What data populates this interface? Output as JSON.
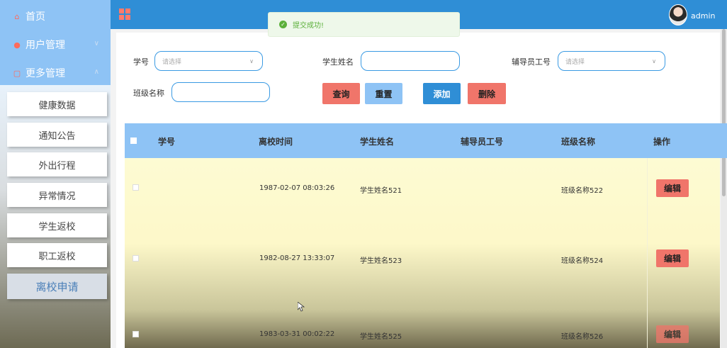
{
  "sidebar": {
    "home": "首页",
    "user_mgmt": "用户管理",
    "more_mgmt": "更多管理",
    "sub_items": [
      "健康数据",
      "通知公告",
      "外出行程",
      "异常情况",
      "学生返校",
      "职工返校",
      "离校申请"
    ]
  },
  "header": {
    "user": "admin"
  },
  "toast": {
    "message": "提交成功!"
  },
  "search": {
    "student_id_label": "学号",
    "student_id_placeholder": "请选择",
    "student_name_label": "学生姓名",
    "counselor_id_label": "辅导员工号",
    "counselor_id_placeholder": "请选择",
    "class_name_label": "班级名称"
  },
  "buttons": {
    "query": "查询",
    "reset": "重置",
    "add": "添加",
    "delete": "删除",
    "edit": "编辑"
  },
  "table": {
    "columns": [
      "学号",
      "离校时间",
      "学生姓名",
      "辅导员工号",
      "班级名称",
      "操作"
    ],
    "rows": [
      {
        "student_id": "",
        "leave_time": "1987-02-07 08:03:26",
        "student_name": "学生姓名521",
        "counselor_id": "",
        "class_name": "班级名称522"
      },
      {
        "student_id": "",
        "leave_time": "1982-08-27 13:33:07",
        "student_name": "学生姓名523",
        "counselor_id": "",
        "class_name": "班级名称524"
      },
      {
        "student_id": "",
        "leave_time": "1983-03-31 00:02:22",
        "student_name": "学生姓名525",
        "counselor_id": "",
        "class_name": "班级名称526"
      }
    ]
  },
  "colors": {
    "primary": "#2f8ed6",
    "light_blue": "#8ec3f5",
    "salmon": "#f0756a",
    "row_bg": "#fdfbd3"
  }
}
